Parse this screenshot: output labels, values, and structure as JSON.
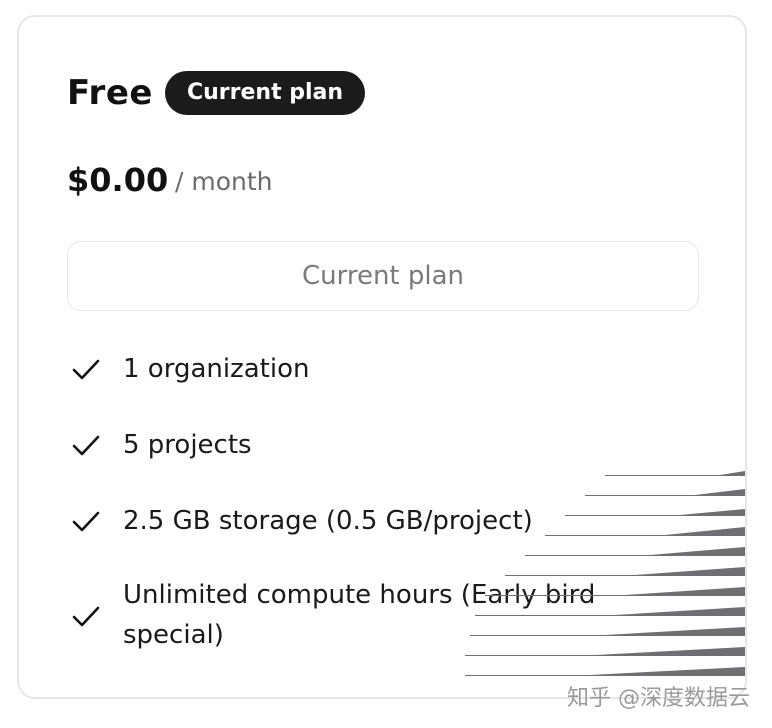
{
  "plan": {
    "name": "Free",
    "badge": "Current plan",
    "price": "$0.00",
    "period": "/ month",
    "cta_label": "Current plan"
  },
  "features": [
    {
      "label": "1 organization",
      "icon": "check-icon"
    },
    {
      "label": "5 projects",
      "icon": "check-icon"
    },
    {
      "label": "2.5 GB storage (0.5 GB/project)",
      "icon": "check-icon"
    },
    {
      "label": "Unlimited compute hours (Early bird special)",
      "icon": "check-icon"
    }
  ],
  "watermark": "知乎 @深度数据云",
  "colors": {
    "badge_bg": "#1b1b1b",
    "card_border": "#e6e6e6",
    "muted_text": "#6b6b6b"
  }
}
